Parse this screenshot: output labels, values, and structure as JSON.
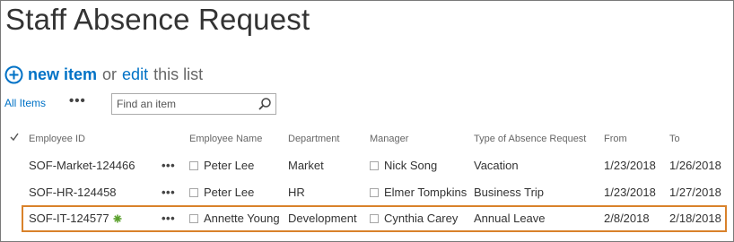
{
  "page": {
    "title": "Staff Absence Request"
  },
  "command_bar": {
    "new_item": "new item",
    "or": "or",
    "edit": "edit",
    "this_list": "this list"
  },
  "views": {
    "all_items": "All Items",
    "more": "•••",
    "search_placeholder": "Find an item"
  },
  "columns": {
    "employee_id": "Employee ID",
    "employee_name": "Employee Name",
    "department": "Department",
    "manager": "Manager",
    "absence_type": "Type of Absence Request",
    "from": "From",
    "to": "To"
  },
  "rows": [
    {
      "employee_id": "SOF-Market-124466",
      "menu": "•••",
      "employee_name": "Peter Lee",
      "department": "Market",
      "manager": "Nick Song",
      "absence_type": "Vacation",
      "from": "1/23/2018",
      "to": "1/26/2018",
      "is_new": false,
      "selected": false
    },
    {
      "employee_id": "SOF-HR-124458",
      "menu": "•••",
      "employee_name": "Peter Lee",
      "department": "HR",
      "manager": "Elmer Tompkins",
      "absence_type": "Business Trip",
      "from": "1/23/2018",
      "to": "1/27/2018",
      "is_new": false,
      "selected": false
    },
    {
      "employee_id": "SOF-IT-124577",
      "menu": "•••",
      "employee_name": "Annette Young",
      "department": "Development",
      "manager": "Cynthia Carey",
      "absence_type": "Annual Leave",
      "from": "2/8/2018",
      "to": "2/18/2018",
      "is_new": true,
      "selected": true
    }
  ],
  "colors": {
    "link": "#0072c6",
    "text": "#333333",
    "header": "#666666",
    "selection_border": "#d9822b",
    "new_icon": "#5aa02c"
  }
}
